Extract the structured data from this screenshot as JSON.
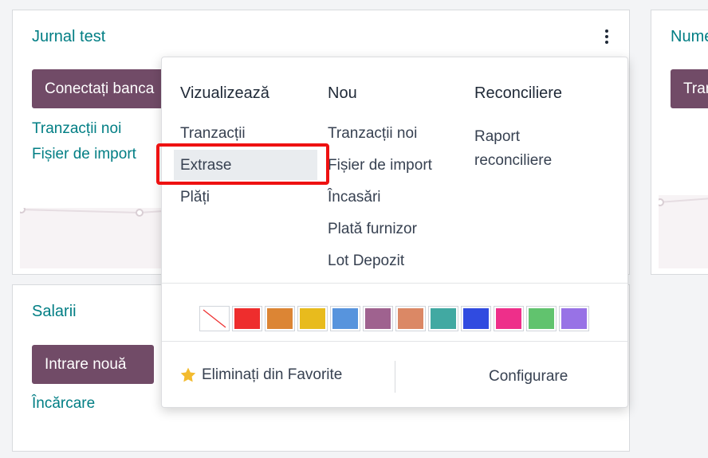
{
  "journal_card": {
    "title": "Jurnal test",
    "connect_button": "Conectați banca",
    "links": [
      "Tranzacții noi",
      "Fișier de import"
    ]
  },
  "right_card": {
    "title": "Numerar",
    "button": "Tranzacții noi"
  },
  "salary_card": {
    "title": "Salarii",
    "new_entry_button": "Intrare nouă",
    "upload_link": "Încărcare"
  },
  "dropdown": {
    "columns": [
      {
        "header": "Vizualizează",
        "items": [
          "Tranzacții",
          "Extrase",
          "Plăți"
        ]
      },
      {
        "header": "Nou",
        "items": [
          "Tranzacții noi",
          "Fișier de import",
          "Încasări",
          "Plată furnizor",
          "Lot Depozit"
        ]
      },
      {
        "header": "Reconciliere",
        "items": [
          "Raport reconciliere"
        ]
      }
    ],
    "colors": [
      "none",
      "#ee2d2d",
      "#dc8534",
      "#e8bb1d",
      "#5794dd",
      "#9f628f",
      "#db8865",
      "#41a9a2",
      "#304be0",
      "#ee2f8a",
      "#61c36e",
      "#9872e6"
    ],
    "favorite_label": "Eliminați din Favorite",
    "configure_label": "Configurare"
  }
}
